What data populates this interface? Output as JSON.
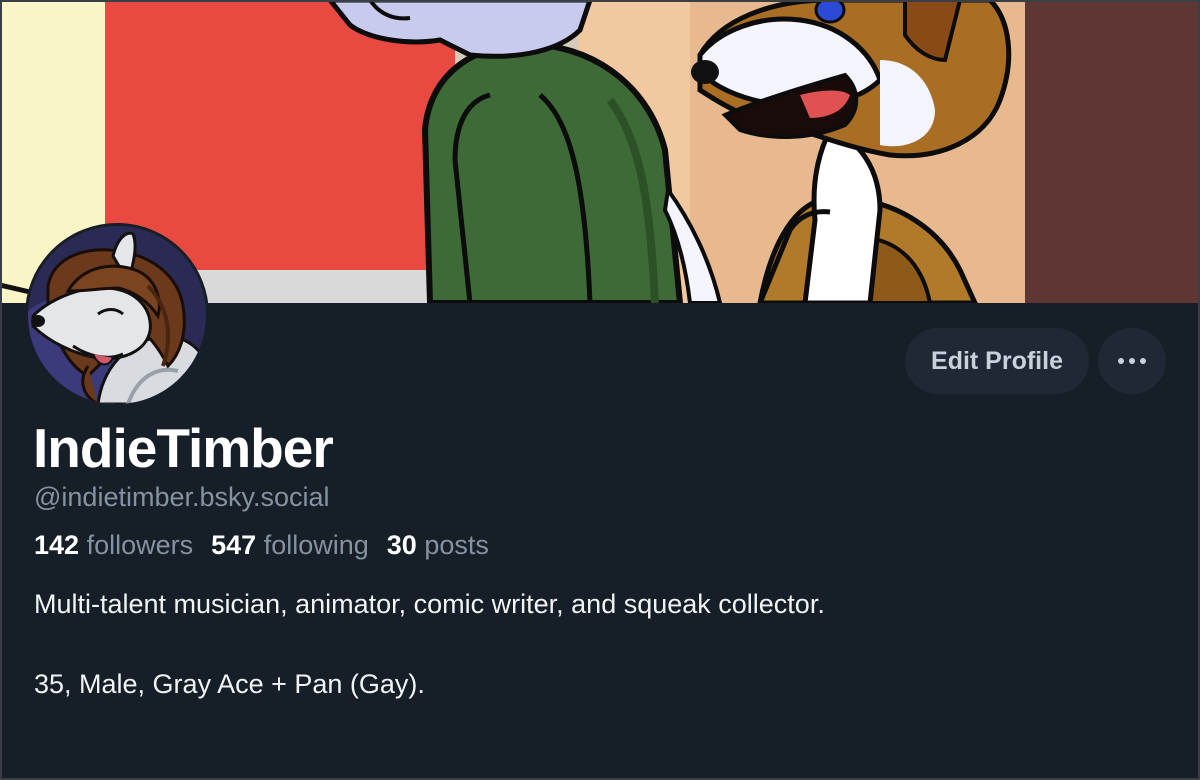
{
  "profile": {
    "display_name": "IndieTimber",
    "handle": "@indietimber.bsky.social",
    "stats": {
      "followers_count": "142",
      "followers_label": "followers",
      "following_count": "547",
      "following_label": "following",
      "posts_count": "30",
      "posts_label": "posts"
    },
    "bio": [
      "Multi-talent musician, animator, comic writer, and squeak collector.",
      "35, Male, Gray Ace + Pan (Gay)."
    ]
  },
  "actions": {
    "edit_profile_label": "Edit Profile",
    "more_icon": "ellipsis-icon"
  },
  "colors": {
    "background": "#161e27",
    "button_bg": "#1f2935",
    "muted_text": "#8592a2",
    "primary_text": "#ffffff"
  }
}
